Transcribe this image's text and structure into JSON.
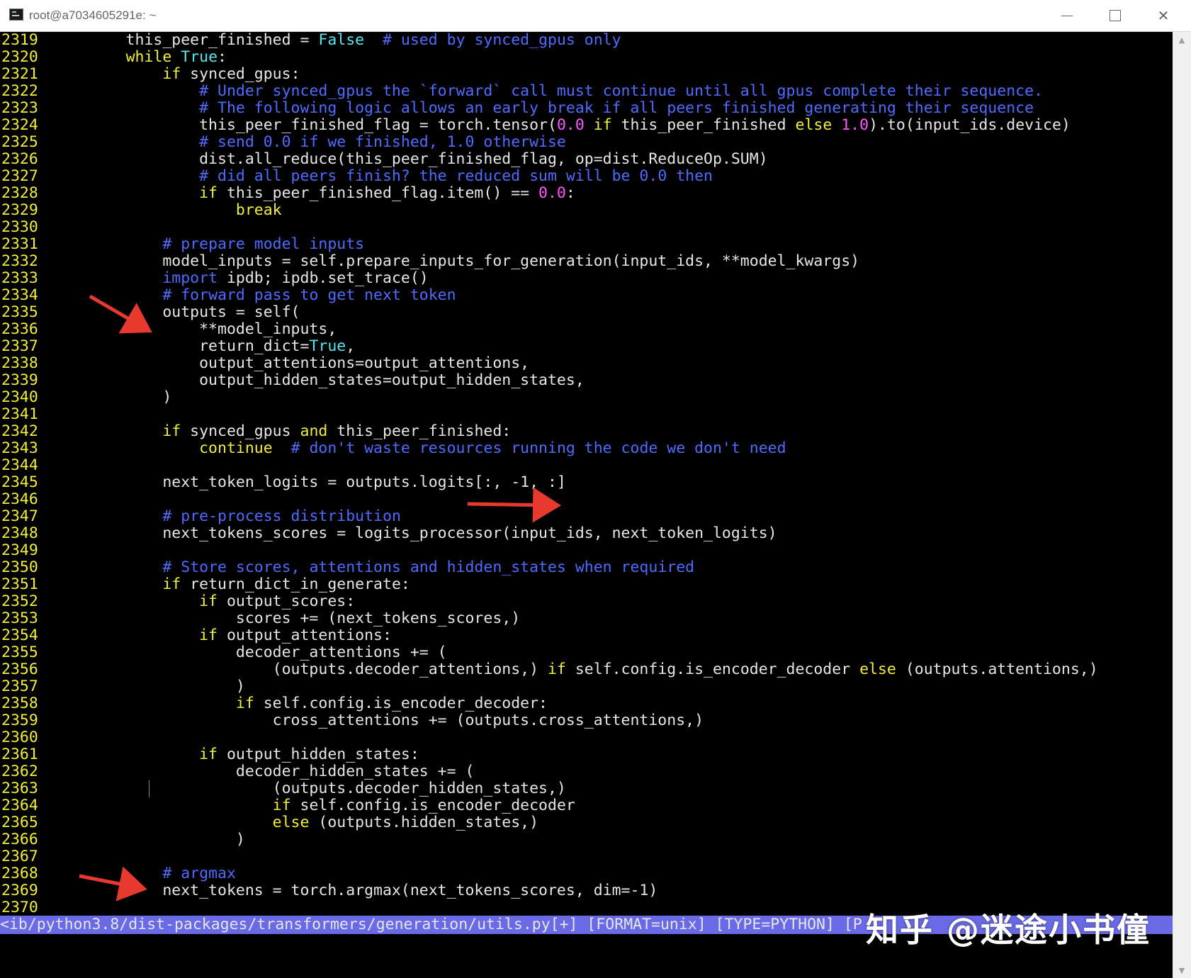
{
  "window": {
    "title": "root@a7034605291e: ~",
    "controls": {
      "minimize": "—",
      "maximize": "□",
      "close": "✕"
    }
  },
  "colors": {
    "line_number": "#f2ee33",
    "keyword": "#f2ee33",
    "comment": "#4f6bff",
    "builtin_constant": "#56e6ee",
    "number": "#ff55ff",
    "text": "#e6e6e6",
    "status_bar": "#6a6ae6",
    "arrow": "#e8392e"
  },
  "code_lines": [
    {
      "n": "2319",
      "tokens": [
        [
          "t",
          "        this_peer_finished = "
        ],
        [
          "bi",
          "False"
        ],
        [
          "t",
          "  "
        ],
        [
          "cm",
          "# used by synced_gpus only"
        ]
      ]
    },
    {
      "n": "2320",
      "tokens": [
        [
          "t",
          "        "
        ],
        [
          "kw",
          "while"
        ],
        [
          "t",
          " "
        ],
        [
          "bi",
          "True"
        ],
        [
          "t",
          ":"
        ]
      ]
    },
    {
      "n": "2321",
      "tokens": [
        [
          "t",
          "            "
        ],
        [
          "kw",
          "if"
        ],
        [
          "t",
          " synced_gpus:"
        ]
      ]
    },
    {
      "n": "2322",
      "tokens": [
        [
          "t",
          "                "
        ],
        [
          "cm",
          "# Under synced_gpus the `forward` call must continue until all gpus complete their sequence."
        ]
      ]
    },
    {
      "n": "2323",
      "tokens": [
        [
          "t",
          "                "
        ],
        [
          "cm",
          "# The following logic allows an early break if all peers finished generating their sequence"
        ]
      ]
    },
    {
      "n": "2324",
      "tokens": [
        [
          "t",
          "                this_peer_finished_flag = torch.tensor("
        ],
        [
          "num",
          "0.0"
        ],
        [
          "t",
          " "
        ],
        [
          "kw",
          "if"
        ],
        [
          "t",
          " this_peer_finished "
        ],
        [
          "kw",
          "else"
        ],
        [
          "t",
          " "
        ],
        [
          "num",
          "1.0"
        ],
        [
          "t",
          ").to(input_ids.device)"
        ]
      ]
    },
    {
      "n": "2325",
      "tokens": [
        [
          "t",
          "                "
        ],
        [
          "cm",
          "# send 0.0 if we finished, 1.0 otherwise"
        ]
      ]
    },
    {
      "n": "2326",
      "tokens": [
        [
          "t",
          "                dist.all_reduce(this_peer_finished_flag, op=dist.ReduceOp.SUM)"
        ]
      ]
    },
    {
      "n": "2327",
      "tokens": [
        [
          "t",
          "                "
        ],
        [
          "cm",
          "# did all peers finish? the reduced sum will be 0.0 then"
        ]
      ]
    },
    {
      "n": "2328",
      "tokens": [
        [
          "t",
          "                "
        ],
        [
          "kw",
          "if"
        ],
        [
          "t",
          " this_peer_finished_flag.item() == "
        ],
        [
          "num",
          "0.0"
        ],
        [
          "t",
          ":"
        ]
      ]
    },
    {
      "n": "2329",
      "tokens": [
        [
          "t",
          "                    "
        ],
        [
          "kw",
          "break"
        ]
      ]
    },
    {
      "n": "2330",
      "tokens": [
        [
          "t",
          ""
        ]
      ]
    },
    {
      "n": "2331",
      "tokens": [
        [
          "t",
          "            "
        ],
        [
          "cm",
          "# prepare model inputs"
        ]
      ]
    },
    {
      "n": "2332",
      "tokens": [
        [
          "t",
          "            model_inputs = self.prepare_inputs_for_generation(input_ids, **model_kwargs)"
        ]
      ]
    },
    {
      "n": "2333",
      "tokens": [
        [
          "t",
          "            "
        ],
        [
          "cm",
          "import"
        ],
        [
          "t",
          " ipdb; ipdb.set_trace()"
        ]
      ]
    },
    {
      "n": "2334",
      "tokens": [
        [
          "t",
          "            "
        ],
        [
          "cm",
          "# forward pass to get next token"
        ]
      ]
    },
    {
      "n": "2335",
      "tokens": [
        [
          "t",
          "            outputs = self("
        ]
      ]
    },
    {
      "n": "2336",
      "tokens": [
        [
          "t",
          "                **model_inputs,"
        ]
      ]
    },
    {
      "n": "2337",
      "tokens": [
        [
          "t",
          "                return_dict="
        ],
        [
          "bi",
          "True"
        ],
        [
          "t",
          ","
        ]
      ]
    },
    {
      "n": "2338",
      "tokens": [
        [
          "t",
          "                output_attentions=output_attentions,"
        ]
      ]
    },
    {
      "n": "2339",
      "tokens": [
        [
          "t",
          "                output_hidden_states=output_hidden_states,"
        ]
      ]
    },
    {
      "n": "2340",
      "tokens": [
        [
          "t",
          "            )"
        ]
      ]
    },
    {
      "n": "2341",
      "tokens": [
        [
          "t",
          ""
        ]
      ]
    },
    {
      "n": "2342",
      "tokens": [
        [
          "t",
          "            "
        ],
        [
          "kw",
          "if"
        ],
        [
          "t",
          " synced_gpus "
        ],
        [
          "kw",
          "and"
        ],
        [
          "t",
          " this_peer_finished:"
        ]
      ]
    },
    {
      "n": "2343",
      "tokens": [
        [
          "t",
          "                "
        ],
        [
          "kw",
          "continue"
        ],
        [
          "t",
          "  "
        ],
        [
          "cm",
          "# don't waste resources running the code we don't need"
        ]
      ]
    },
    {
      "n": "2344",
      "tokens": [
        [
          "t",
          ""
        ]
      ]
    },
    {
      "n": "2345",
      "tokens": [
        [
          "t",
          "            next_token_logits = outputs.logits[:, -1, :]"
        ]
      ]
    },
    {
      "n": "2346",
      "tokens": [
        [
          "t",
          ""
        ]
      ]
    },
    {
      "n": "2347",
      "tokens": [
        [
          "t",
          "            "
        ],
        [
          "cm",
          "# pre-process distribution"
        ]
      ]
    },
    {
      "n": "2348",
      "tokens": [
        [
          "t",
          "            next_tokens_scores = logits_processor(input_ids, next_token_logits)"
        ]
      ]
    },
    {
      "n": "2349",
      "tokens": [
        [
          "t",
          ""
        ]
      ]
    },
    {
      "n": "2350",
      "tokens": [
        [
          "t",
          "            "
        ],
        [
          "cm",
          "# Store scores, attentions and hidden_states when required"
        ]
      ]
    },
    {
      "n": "2351",
      "tokens": [
        [
          "t",
          "            "
        ],
        [
          "kw",
          "if"
        ],
        [
          "t",
          " return_dict_in_generate:"
        ]
      ]
    },
    {
      "n": "2352",
      "tokens": [
        [
          "t",
          "                "
        ],
        [
          "kw",
          "if"
        ],
        [
          "t",
          " output_scores:"
        ]
      ]
    },
    {
      "n": "2353",
      "tokens": [
        [
          "t",
          "                    scores += (next_tokens_scores,)"
        ]
      ]
    },
    {
      "n": "2354",
      "tokens": [
        [
          "t",
          "                "
        ],
        [
          "kw",
          "if"
        ],
        [
          "t",
          " output_attentions:"
        ]
      ]
    },
    {
      "n": "2355",
      "tokens": [
        [
          "t",
          "                    decoder_attentions += ("
        ]
      ]
    },
    {
      "n": "2356",
      "tokens": [
        [
          "t",
          "                        (outputs.decoder_attentions,) "
        ],
        [
          "kw",
          "if"
        ],
        [
          "t",
          " self.config.is_encoder_decoder "
        ],
        [
          "kw",
          "else"
        ],
        [
          "t",
          " (outputs.attentions,)"
        ]
      ]
    },
    {
      "n": "2357",
      "tokens": [
        [
          "t",
          "                    )"
        ]
      ]
    },
    {
      "n": "2358",
      "tokens": [
        [
          "t",
          "                    "
        ],
        [
          "kw",
          "if"
        ],
        [
          "t",
          " self.config.is_encoder_decoder:"
        ]
      ]
    },
    {
      "n": "2359",
      "tokens": [
        [
          "t",
          "                        cross_attentions += (outputs.cross_attentions,)"
        ]
      ]
    },
    {
      "n": "2360",
      "tokens": [
        [
          "t",
          ""
        ]
      ]
    },
    {
      "n": "2361",
      "tokens": [
        [
          "t",
          "                "
        ],
        [
          "kw",
          "if"
        ],
        [
          "t",
          " output_hidden_states:"
        ]
      ]
    },
    {
      "n": "2362",
      "tokens": [
        [
          "t",
          "                    decoder_hidden_states += ("
        ]
      ]
    },
    {
      "n": "2363",
      "tokens": [
        [
          "t",
          "                        (outputs.decoder_hidden_states,)"
        ]
      ]
    },
    {
      "n": "2364",
      "tokens": [
        [
          "t",
          "                        "
        ],
        [
          "kw",
          "if"
        ],
        [
          "t",
          " self.config.is_encoder_decoder"
        ]
      ]
    },
    {
      "n": "2365",
      "tokens": [
        [
          "t",
          "                        "
        ],
        [
          "kw",
          "else"
        ],
        [
          "t",
          " (outputs.hidden_states,)"
        ]
      ]
    },
    {
      "n": "2366",
      "tokens": [
        [
          "t",
          "                    )"
        ]
      ]
    },
    {
      "n": "2367",
      "tokens": [
        [
          "t",
          ""
        ]
      ]
    },
    {
      "n": "2368",
      "tokens": [
        [
          "t",
          "            "
        ],
        [
          "cm",
          "# argmax"
        ]
      ]
    },
    {
      "n": "2369",
      "tokens": [
        [
          "t",
          "            next_tokens = torch.argmax(next_tokens_scores, dim=-1)"
        ]
      ]
    },
    {
      "n": "2370",
      "tokens": [
        [
          "t",
          ""
        ]
      ]
    }
  ],
  "status_bar": {
    "text": "<ib/python3.8/dist-packages/transformers/generation/utils.py[+] [FORMAT=unix] [TYPE=PYTHON] [P"
  },
  "watermark": "知乎 @迷途小书僮"
}
